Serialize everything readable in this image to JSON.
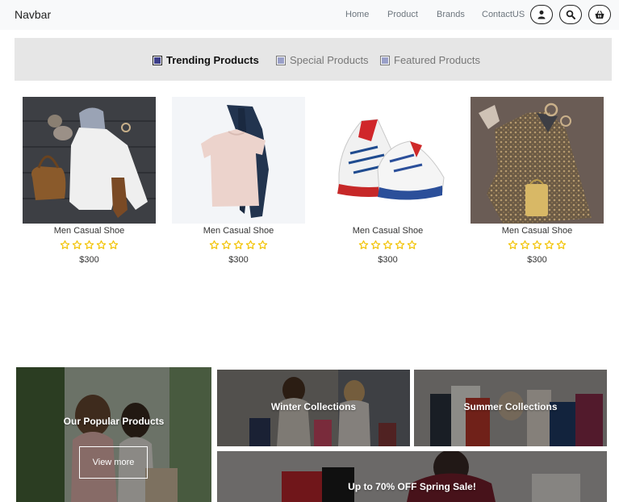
{
  "navbar": {
    "brand": "Navbar",
    "links": [
      "Home",
      "Product",
      "Brands",
      "ContactUS"
    ],
    "icons": [
      "user-icon",
      "search-icon",
      "basket-icon"
    ]
  },
  "tabs": [
    {
      "label": "Trending Products",
      "active": true
    },
    {
      "label": "Special Products",
      "active": false
    },
    {
      "label": "Featured Products",
      "active": false
    }
  ],
  "products": [
    {
      "name": "Men Casual Shoe",
      "price": "$300",
      "rating": 0,
      "max_rating": 5
    },
    {
      "name": "Men Casual Shoe",
      "price": "$300",
      "rating": 0,
      "max_rating": 5
    },
    {
      "name": "Men Casual Shoe",
      "price": "$300",
      "rating": 0,
      "max_rating": 5
    },
    {
      "name": "Men Casual Shoe",
      "price": "$300",
      "rating": 0,
      "max_rating": 5
    }
  ],
  "banners": {
    "popular": {
      "title": "Our Popular Products",
      "button": "View more"
    },
    "winter": {
      "title": "Winter Collections"
    },
    "summer": {
      "title": "Summer Collections"
    },
    "sale": {
      "title": "Up to 70% OFF Spring Sale!"
    }
  },
  "colors": {
    "star": "#f2c200",
    "tab_active_fill": "#3d3f8a",
    "tab_inactive_fill": "#9aa0c8"
  }
}
